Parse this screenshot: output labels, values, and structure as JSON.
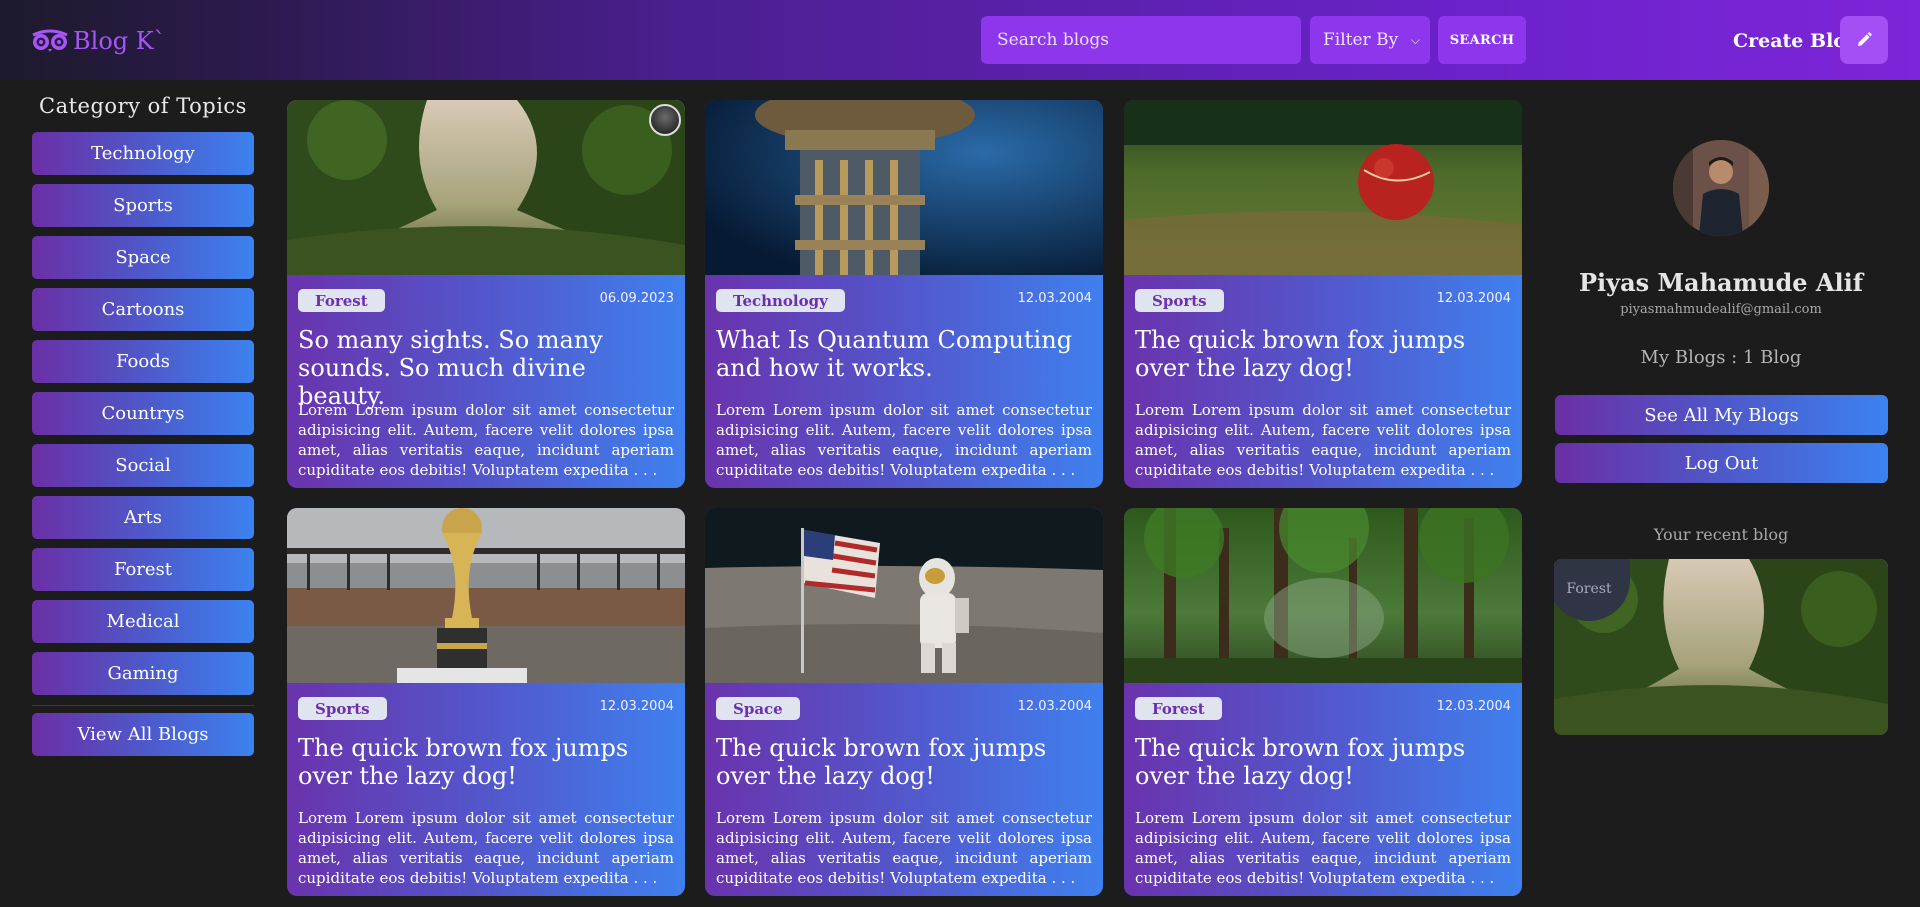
{
  "header": {
    "logo_text": "Blog K`",
    "search_placeholder": "Search blogs",
    "filter_label": "Filter By",
    "search_button": "SEARCH",
    "create_label": "Create Blog"
  },
  "sidebar": {
    "title": "Category of Topics",
    "categories": [
      "Technology",
      "Sports",
      "Space",
      "Cartoons",
      "Foods",
      "Countrys",
      "Social",
      "Arts",
      "Forest",
      "Medical",
      "Gaming"
    ],
    "view_all": "View All Blogs"
  },
  "cards": [
    {
      "tag": "Forest",
      "date": "06.09.2023",
      "title": "So many sights. So many sounds. So much divine beauty.",
      "excerpt": "Lorem Lorem ipsum dolor sit amet consectetur adipisicing elit. Autem, facere velit dolores ipsa amet, alias veritatis eaque, incidunt aperiam cupiditate eos debitis! Voluptatem expedita . . ."
    },
    {
      "tag": "Technology",
      "date": "12.03.2004",
      "title": "What Is Quantum Computing and how it works.",
      "excerpt": "Lorem Lorem ipsum dolor sit amet consectetur adipisicing elit. Autem, facere velit dolores ipsa amet, alias veritatis eaque, incidunt aperiam cupiditate eos debitis! Voluptatem expedita . . ."
    },
    {
      "tag": "Sports",
      "date": "12.03.2004",
      "title": "The quick brown fox jumps over the lazy dog!",
      "excerpt": "Lorem Lorem ipsum dolor sit amet consectetur adipisicing elit. Autem, facere velit dolores ipsa amet, alias veritatis eaque, incidunt aperiam cupiditate eos debitis! Voluptatem expedita . . ."
    },
    {
      "tag": "Sports",
      "date": "12.03.2004",
      "title": "The quick brown fox jumps over the lazy dog!",
      "excerpt": "Lorem Lorem ipsum dolor sit amet consectetur adipisicing elit. Autem, facere velit dolores ipsa amet, alias veritatis eaque, incidunt aperiam cupiditate eos debitis! Voluptatem expedita . . ."
    },
    {
      "tag": "Space",
      "date": "12.03.2004",
      "title": "The quick brown fox jumps over the lazy dog!",
      "excerpt": "Lorem Lorem ipsum dolor sit amet consectetur adipisicing elit. Autem, facere velit dolores ipsa amet, alias veritatis eaque, incidunt aperiam cupiditate eos debitis! Voluptatem expedita . . ."
    },
    {
      "tag": "Forest",
      "date": "12.03.2004",
      "title": "The quick brown fox jumps over the lazy dog!",
      "excerpt": "Lorem Lorem ipsum dolor sit amet consectetur adipisicing elit. Autem, facere velit dolores ipsa amet, alias veritatis eaque, incidunt aperiam cupiditate eos debitis! Voluptatem expedita . . ."
    }
  ],
  "profile": {
    "name": "Piyas Mahamude Alif",
    "email": "piyasmahmudealif@gmail.com",
    "blog_count": "My Blogs : 1 Blog",
    "see_all": "See All My Blogs",
    "logout": "Log Out",
    "recent_label": "Your recent blog",
    "recent_tag": "Forest"
  },
  "icons": {
    "logo": "owl-glasses-icon",
    "create": "pencil-icon",
    "filter": "chevron-down-icon"
  },
  "colors": {
    "accent": "#8e36ec",
    "logo": "#a855f7",
    "background": "#1c1c1c"
  }
}
